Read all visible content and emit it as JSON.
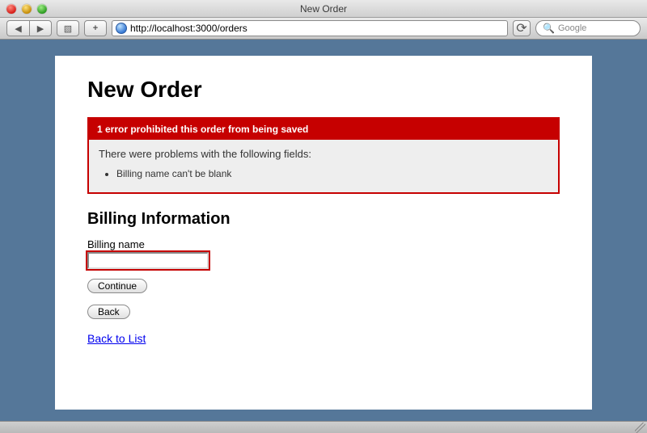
{
  "window": {
    "title": "New Order"
  },
  "toolbar": {
    "url": "http://localhost:3000/orders",
    "search_placeholder": "Google"
  },
  "page": {
    "heading": "New Order",
    "error": {
      "header": "1 error prohibited this order from being saved",
      "intro": "There were problems with the following fields:",
      "messages": [
        "Billing name can't be blank"
      ]
    },
    "section_heading": "Billing Information",
    "fields": {
      "billing_name": {
        "label": "Billing name",
        "value": ""
      }
    },
    "buttons": {
      "continue": "Continue",
      "back": "Back"
    },
    "links": {
      "back_to_list": "Back to List"
    }
  }
}
